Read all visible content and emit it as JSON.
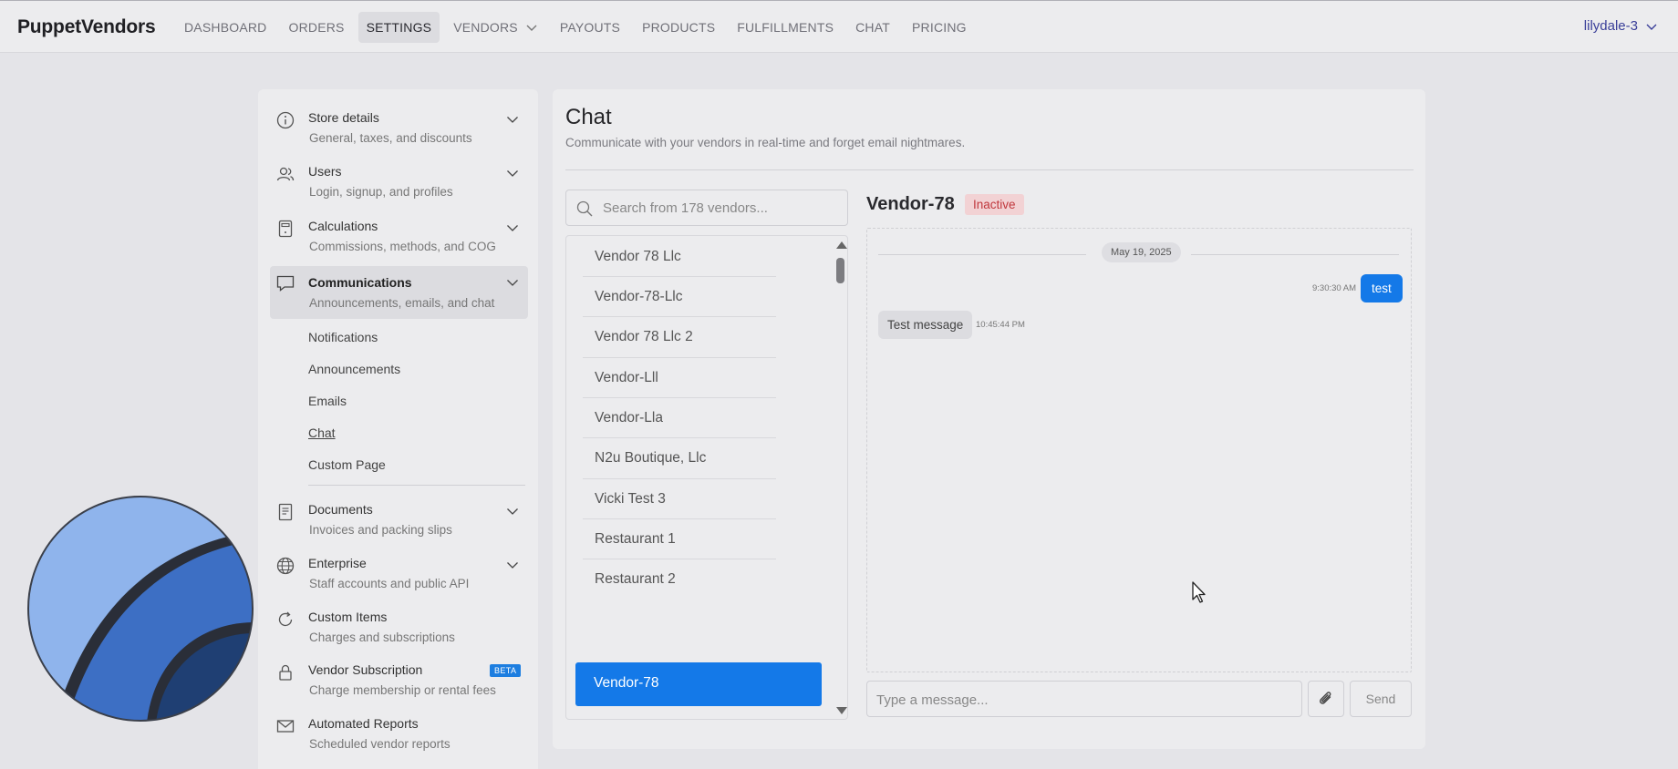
{
  "app": {
    "brand": "PuppetVendors",
    "user": "lilydale-3",
    "nav": [
      {
        "label": "DASHBOARD",
        "active": false
      },
      {
        "label": "ORDERS",
        "active": false
      },
      {
        "label": "SETTINGS",
        "active": true
      },
      {
        "label": "VENDORS",
        "active": false,
        "dropdown": true
      },
      {
        "label": "PAYOUTS",
        "active": false
      },
      {
        "label": "PRODUCTS",
        "active": false
      },
      {
        "label": "FULFILLMENTS",
        "active": false
      },
      {
        "label": "CHAT",
        "active": false
      },
      {
        "label": "PRICING",
        "active": false
      }
    ]
  },
  "settings": {
    "groups": [
      {
        "title": "Store details",
        "desc": "General, taxes, and discounts",
        "icon": "info-icon"
      },
      {
        "title": "Users",
        "desc": "Login, signup, and profiles",
        "icon": "users-icon"
      },
      {
        "title": "Calculations",
        "desc": "Commissions, methods, and COG",
        "icon": "calculator-icon"
      },
      {
        "title": "Communications",
        "desc": "Announcements, emails, and chat",
        "icon": "chat-bubble-icon"
      },
      {
        "title": "Documents",
        "desc": "Invoices and packing slips",
        "icon": "document-icon"
      },
      {
        "title": "Enterprise",
        "desc": "Staff accounts and public API",
        "icon": "globe-icon"
      },
      {
        "title": "Custom Items",
        "desc": "Charges and subscriptions",
        "icon": "refresh-icon"
      },
      {
        "title": "Vendor Subscription",
        "desc": "Charge membership or rental fees",
        "icon": "lock-icon",
        "badge": "BETA"
      },
      {
        "title": "Automated Reports",
        "desc": "Scheduled vendor reports",
        "icon": "mail-icon"
      }
    ],
    "sub_items": [
      "Notifications",
      "Announcements",
      "Emails",
      "Chat",
      "Custom Page"
    ]
  },
  "chat": {
    "title": "Chat",
    "subtitle": "Communicate with your vendors in real-time and forget email nightmares.",
    "search_placeholder": "Search from 178 vendors...",
    "vendors": [
      "Vendor 78 Llc",
      "Vendor-78-Llc",
      "Vendor 78 Llc 2",
      "Vendor-Lll",
      "Vendor-Lla",
      "N2u Boutique, Llc",
      "Vicki Test 3",
      "Restaurant 1",
      "Restaurant 2",
      "Vendor-78"
    ],
    "selected_vendor": "Vendor-78",
    "status": "Inactive",
    "date": "May 19, 2025",
    "messages": {
      "out_text": "test",
      "out_time": "9:30:30 AM",
      "in_text": "Test message",
      "in_time": "10:45:44 PM"
    },
    "composer_placeholder": "Type a message...",
    "send_label": "Send"
  },
  "colors": {
    "accent": "#1479e8",
    "inactive_text": "#c0373c",
    "inactive_bg": "#f2d2d4"
  }
}
